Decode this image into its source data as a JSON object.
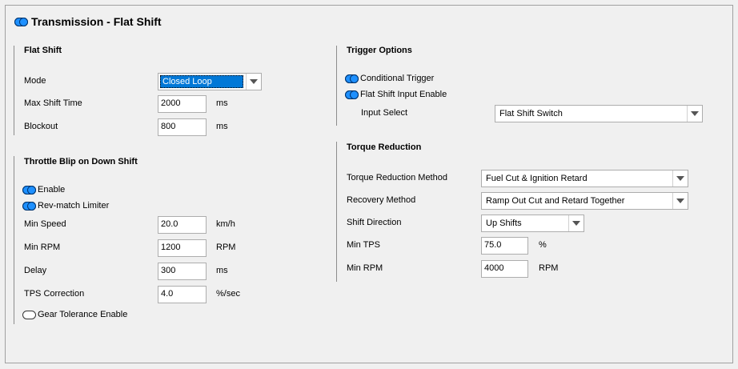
{
  "header": {
    "title": "Transmission - Flat Shift"
  },
  "flat_shift": {
    "section_title": "Flat Shift",
    "mode_label": "Mode",
    "mode_value": "Closed Loop",
    "max_shift_time_label": "Max Shift Time",
    "max_shift_time_value": "2000",
    "max_shift_time_unit": "ms",
    "blockout_label": "Blockout",
    "blockout_value": "800",
    "blockout_unit": "ms"
  },
  "throttle_blip": {
    "section_title": "Throttle Blip on Down Shift",
    "enable_label": "Enable",
    "enable_on": true,
    "rev_match_label": "Rev-match Limiter",
    "rev_match_on": true,
    "min_speed_label": "Min Speed",
    "min_speed_value": "20.0",
    "min_speed_unit": "km/h",
    "min_rpm_label": "Min RPM",
    "min_rpm_value": "1200",
    "min_rpm_unit": "RPM",
    "delay_label": "Delay",
    "delay_value": "300",
    "delay_unit": "ms",
    "tps_label": "TPS Correction",
    "tps_value": "4.0",
    "tps_unit": "%/sec",
    "gear_tol_label": "Gear Tolerance Enable",
    "gear_tol_on": false
  },
  "trigger_options": {
    "section_title": "Trigger Options",
    "conditional_label": "Conditional Trigger",
    "conditional_on": true,
    "input_enable_label": "Flat Shift Input Enable",
    "input_enable_on": true,
    "input_select_label": "Input Select",
    "input_select_value": "Flat Shift Switch"
  },
  "torque_reduction": {
    "section_title": "Torque Reduction",
    "method_label": "Torque Reduction Method",
    "method_value": "Fuel Cut & Ignition Retard",
    "recovery_label": "Recovery Method",
    "recovery_value": "Ramp Out Cut and Retard Together",
    "direction_label": "Shift Direction",
    "direction_value": "Up Shifts",
    "min_tps_label": "Min TPS",
    "min_tps_value": "75.0",
    "min_tps_unit": "%",
    "min_rpm_label": "Min RPM",
    "min_rpm_value": "4000",
    "min_rpm_unit": "RPM"
  },
  "colors": {
    "toggle_on": "#1e90ff",
    "selection": "#0078d7"
  }
}
